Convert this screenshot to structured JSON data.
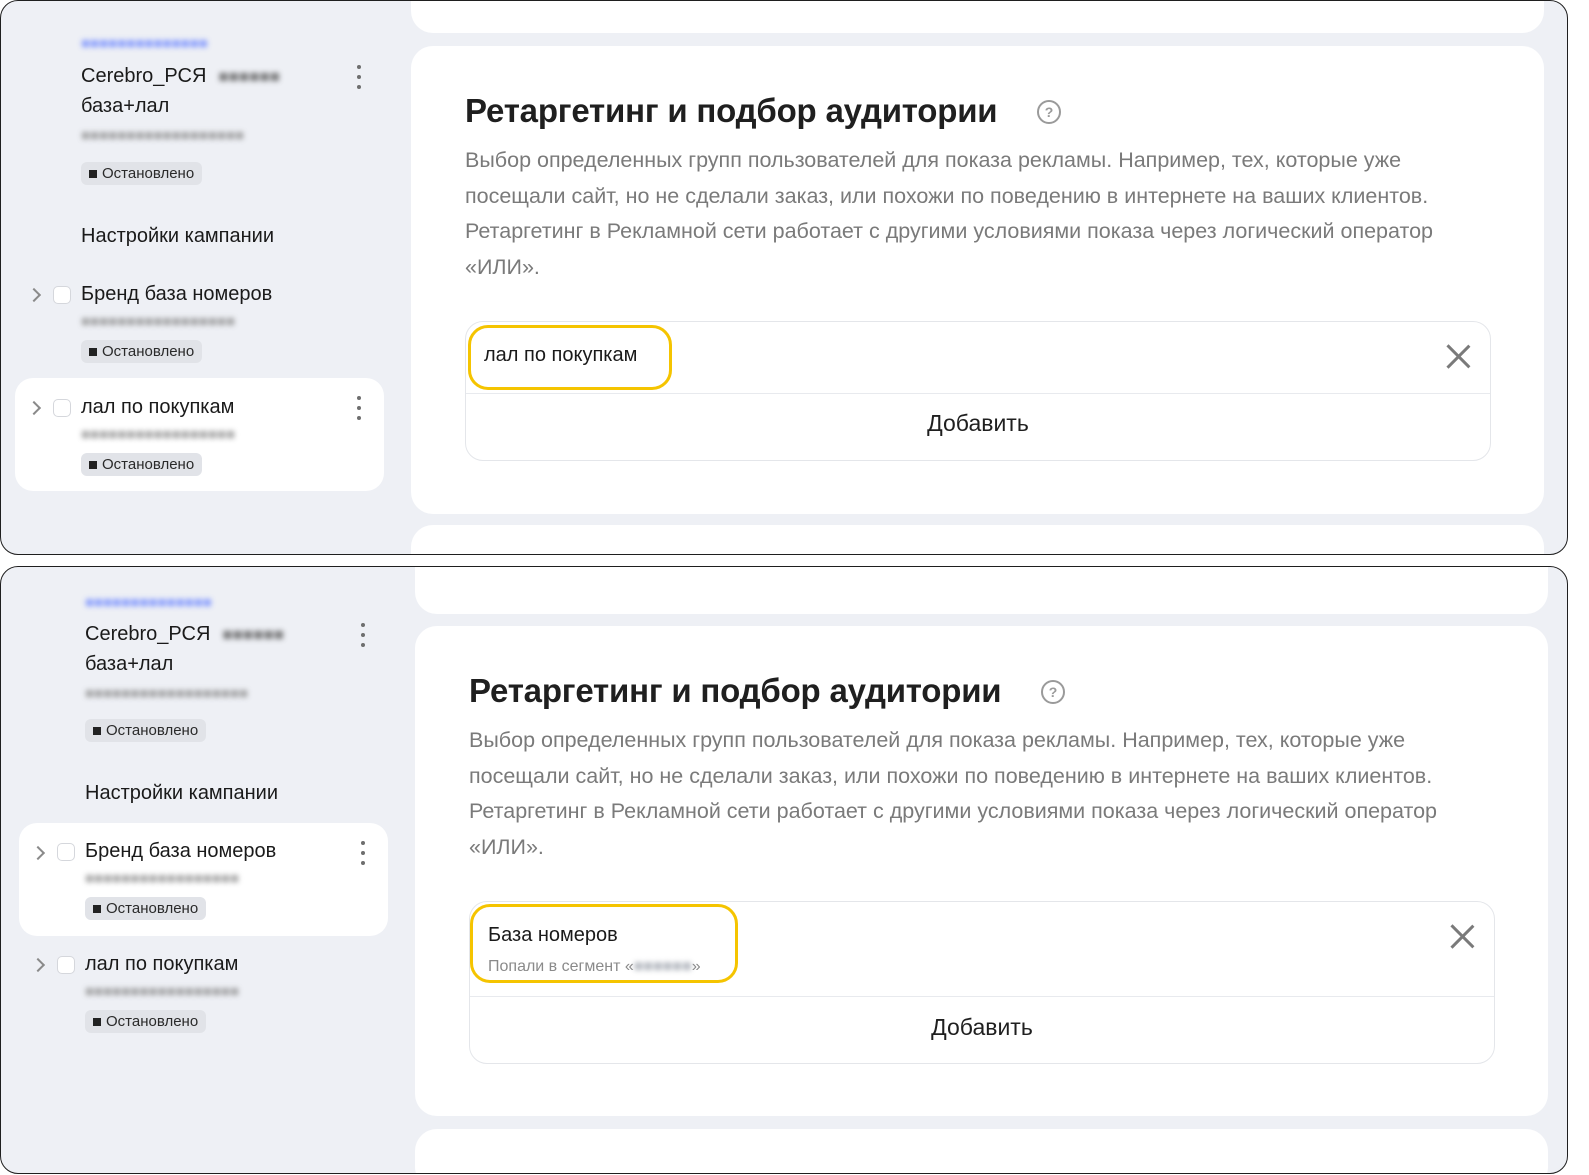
{
  "colors": {
    "panel_bg": "#eef0f5",
    "card_bg": "#ffffff",
    "highlight": "#f5c400",
    "link": "#6a84ff",
    "muted_text": "#7a7a7a"
  },
  "icons": [
    "kebab-icon",
    "chevron-right-icon",
    "checkbox-icon",
    "help-icon",
    "close-icon",
    "status-square-icon"
  ],
  "screens": [
    {
      "sidebar": {
        "campaign_title": "Cerebro_РСЯ",
        "campaign_subtitle": "база+лал",
        "campaign_status": "Остановлено",
        "settings_label": "Настройки кампании",
        "groups": [
          {
            "name": "Бренд база номеров",
            "status": "Остановлено"
          },
          {
            "name": "лал по покупкам",
            "status": "Остановлено"
          }
        ]
      },
      "main": {
        "title": "Ретаргетинг и подбор аудитории",
        "help": "?",
        "description": "Выбор определенных групп пользователей для показа рекламы. Например, тех, которые уже посещали сайт, но не сделали заказ, или похожи по поведению в интернете на ваших клиентов. Ретаргетинг в Рекламной сети работает с другими условиями показа через логический оператор «ИЛИ».",
        "condition": {
          "name": "лал по покупкам",
          "detail": ""
        },
        "add_label": "Добавить"
      }
    },
    {
      "sidebar": {
        "campaign_title": "Cerebro_РСЯ",
        "campaign_subtitle": "база+лал",
        "campaign_status": "Остановлено",
        "settings_label": "Настройки кампании",
        "groups": [
          {
            "name": "Бренд база номеров",
            "status": "Остановлено"
          },
          {
            "name": "лал по покупкам",
            "status": "Остановлено"
          }
        ]
      },
      "main": {
        "title": "Ретаргетинг и подбор аудитории",
        "help": "?",
        "description": "Выбор определенных групп пользователей для показа рекламы. Например, тех, которые уже посещали сайт, но не сделали заказ, или похожи по поведению в интернете на ваших клиентов. Ретаргетинг в Рекламной сети работает с другими условиями показа через логический оператор «ИЛИ».",
        "condition": {
          "name": "База номеров",
          "detail_prefix": "Попали в сегмент «",
          "detail_suffix": "»"
        },
        "add_label": "Добавить"
      }
    }
  ]
}
